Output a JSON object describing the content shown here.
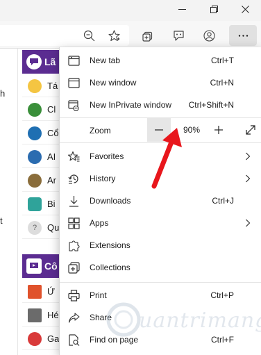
{
  "titlebar": {
    "controls": [
      "minimize",
      "restore",
      "close"
    ]
  },
  "page_fragments": {
    "left_chars": [
      "h",
      "t"
    ],
    "sections": [
      {
        "label": "Lã",
        "color": "#5b2c91"
      },
      {
        "label": "Cô",
        "color": "#5b2c91"
      }
    ],
    "items": [
      "Tá",
      "Cl",
      "Cổ",
      "AI",
      "Ar",
      "Bi",
      "Qu",
      "Ứ",
      "Hé",
      "Ga"
    ]
  },
  "menu": {
    "items_top": [
      {
        "label": "New tab",
        "shortcut": "Ctrl+T",
        "icon": "new-tab-icon"
      },
      {
        "label": "New window",
        "shortcut": "Ctrl+N",
        "icon": "new-window-icon"
      },
      {
        "label": "New InPrivate window",
        "shortcut": "Ctrl+Shift+N",
        "icon": "inprivate-icon"
      }
    ],
    "zoom": {
      "label": "Zoom",
      "level": "90%"
    },
    "items_mid": [
      {
        "label": "Favorites",
        "shortcut": "",
        "icon": "favorites-icon",
        "submenu": true
      },
      {
        "label": "History",
        "shortcut": "",
        "icon": "history-icon",
        "submenu": true
      },
      {
        "label": "Downloads",
        "shortcut": "Ctrl+J",
        "icon": "download-icon",
        "submenu": false
      },
      {
        "label": "Apps",
        "shortcut": "",
        "icon": "apps-icon",
        "submenu": true
      },
      {
        "label": "Extensions",
        "shortcut": "",
        "icon": "extensions-icon",
        "submenu": false
      },
      {
        "label": "Collections",
        "shortcut": "",
        "icon": "collections-icon",
        "submenu": false
      }
    ],
    "items_bottom": [
      {
        "label": "Print",
        "shortcut": "Ctrl+P",
        "icon": "print-icon"
      },
      {
        "label": "Share",
        "shortcut": "",
        "icon": "share-icon"
      },
      {
        "label": "Find on page",
        "shortcut": "Ctrl+F",
        "icon": "find-icon"
      }
    ]
  },
  "watermark": {
    "text": "uantrimang"
  },
  "colors": {
    "accent": "#5b2c91",
    "arrow": "#e8161c",
    "menu_bg": "#ffffff"
  }
}
